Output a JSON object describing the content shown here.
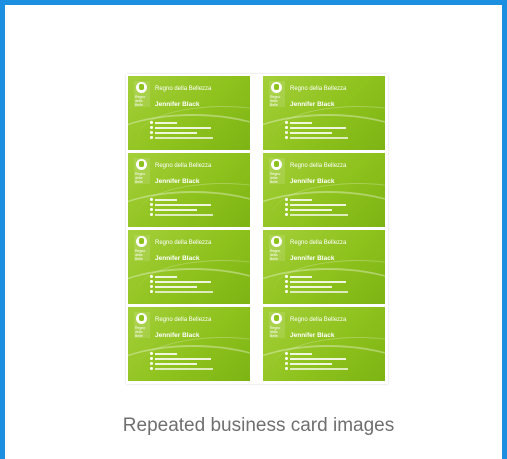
{
  "caption": "Repeated business card images",
  "card": {
    "company": "Regno della Bellezza",
    "person_name": "Jennifer Black",
    "logo_text": "Regno\ndella\nBelle"
  },
  "cards_count": 8,
  "colors": {
    "frame_border": "#1d8fe1",
    "card_green": "#8ec21d",
    "caption_text": "#6f6f6f"
  }
}
